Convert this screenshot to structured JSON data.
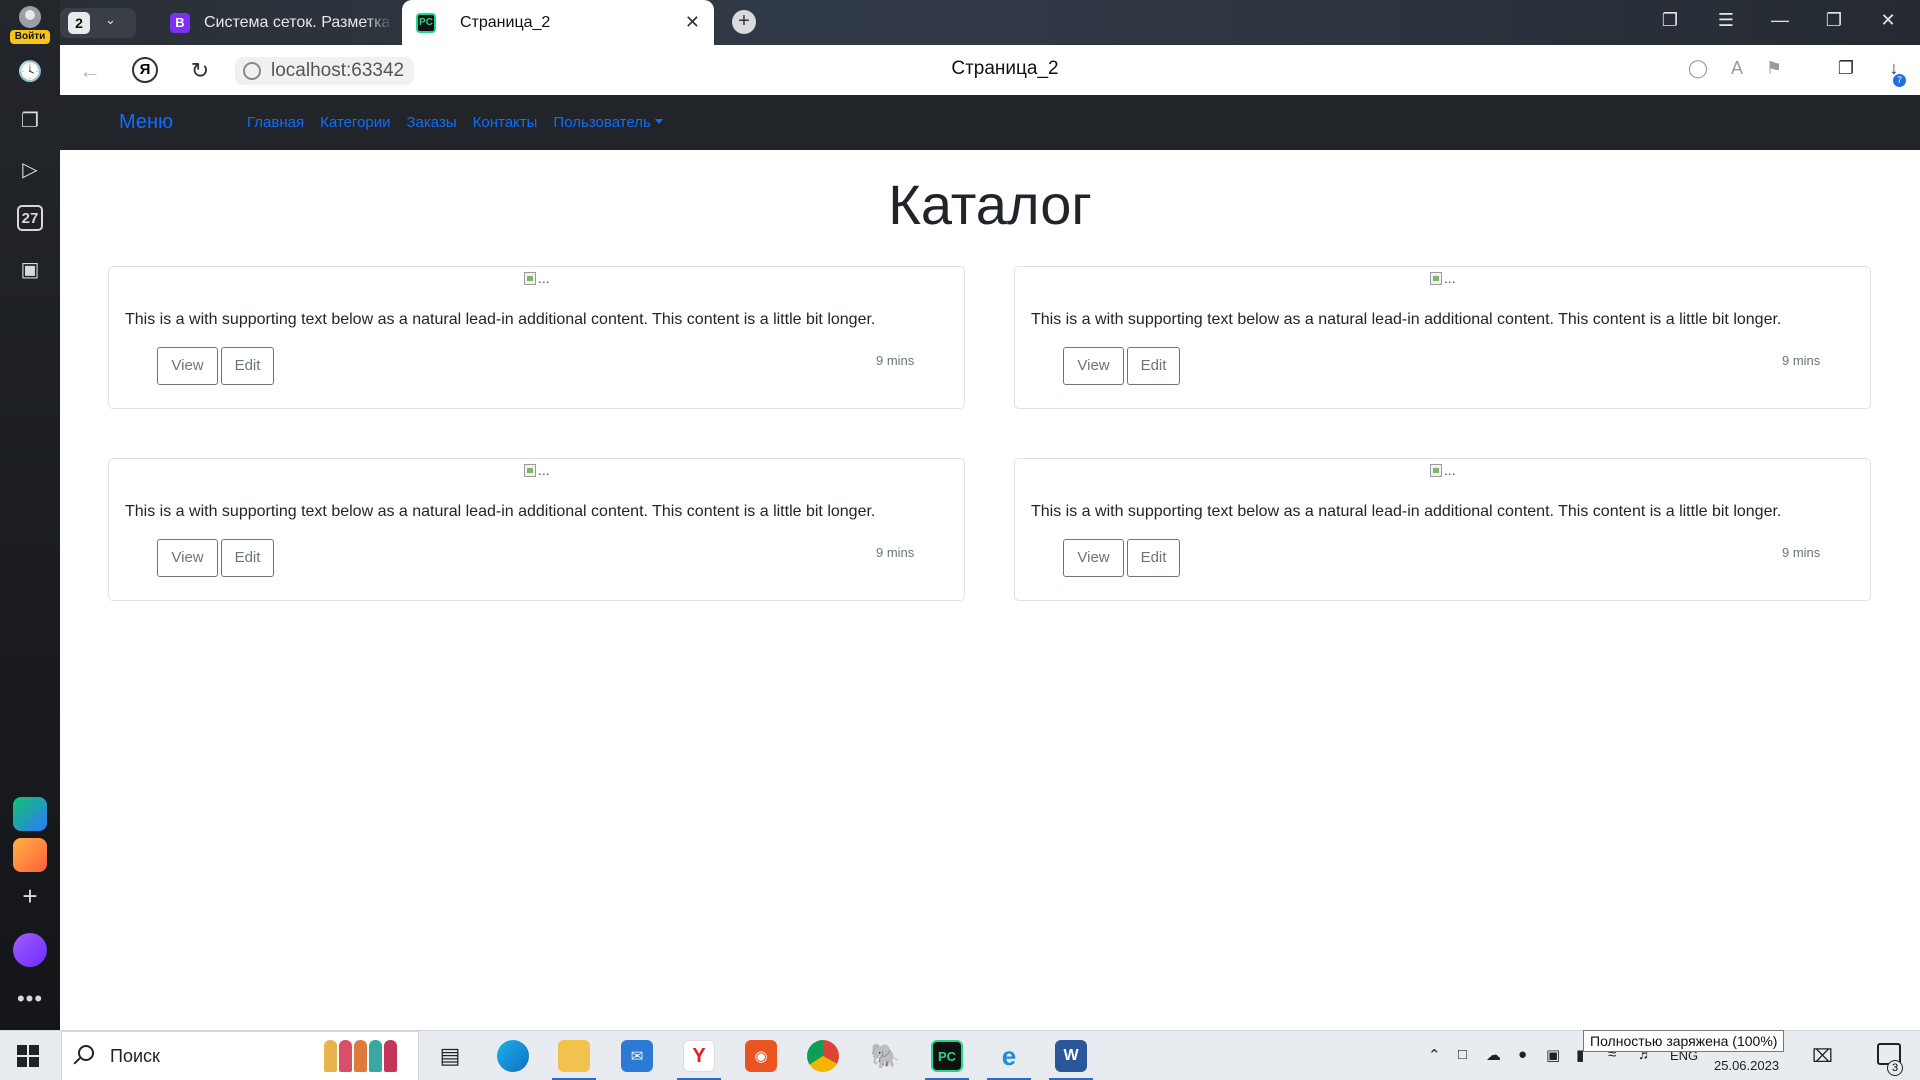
{
  "browser": {
    "profile_label": "Войти",
    "tab_count": "2",
    "tabs": [
      {
        "title": "Система сеток. Разметка",
        "favicon_letter": "B"
      },
      {
        "title": "Страница_2"
      }
    ],
    "url": "localhost:63342",
    "page_title": "Страница_2",
    "download_badge": "7",
    "calendar_day": "27"
  },
  "navbar": {
    "brand": "Меню",
    "links": [
      "Главная",
      "Категории",
      "Заказы",
      "Контакты",
      "Пользователь"
    ]
  },
  "page": {
    "heading": "Каталог"
  },
  "cards": [
    {
      "img_alt": "...",
      "text": "This is a with supporting text below as a natural lead-in additional content. This content is a little bit longer.",
      "view": "View",
      "edit": "Edit",
      "time": "9 mins"
    },
    {
      "img_alt": "...",
      "text": "This is a with supporting text below as a natural lead-in additional content. This content is a little bit longer.",
      "view": "View",
      "edit": "Edit",
      "time": "9 mins"
    },
    {
      "img_alt": "...",
      "text": "This is a with supporting text below as a natural lead-in additional content. This content is a little bit longer.",
      "view": "View",
      "edit": "Edit",
      "time": "9 mins"
    },
    {
      "img_alt": "...",
      "text": "This is a with supporting text below as a natural lead-in additional content. This content is a little bit longer.",
      "view": "View",
      "edit": "Edit",
      "time": "9 mins"
    }
  ],
  "taskbar": {
    "search_placeholder": "Поиск",
    "language": "ENG",
    "date": "25.06.2023",
    "notification_count": "3",
    "battery_tooltip": "Полностью заряжена (100%)"
  },
  "colors": {
    "navbar_bg": "#212529",
    "link": "#0d6efd",
    "outline_button": "#6c757d"
  }
}
